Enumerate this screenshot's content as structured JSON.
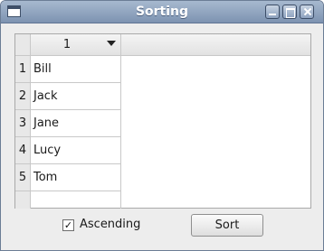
{
  "window": {
    "title": "Sorting"
  },
  "table": {
    "column_header": "1",
    "row_numbers": [
      "1",
      "2",
      "3",
      "4",
      "5"
    ],
    "rows": [
      "Bill",
      "Jack",
      "Jane",
      "Lucy",
      "Tom"
    ]
  },
  "controls": {
    "ascending_checked": true,
    "ascending_label": "Ascending",
    "check_glyph": "✓",
    "sort_label": "Sort"
  },
  "colors": {
    "titlebar_top": "#a7b9cf",
    "titlebar_bottom": "#7d93b1",
    "window_bg": "#ededed"
  }
}
